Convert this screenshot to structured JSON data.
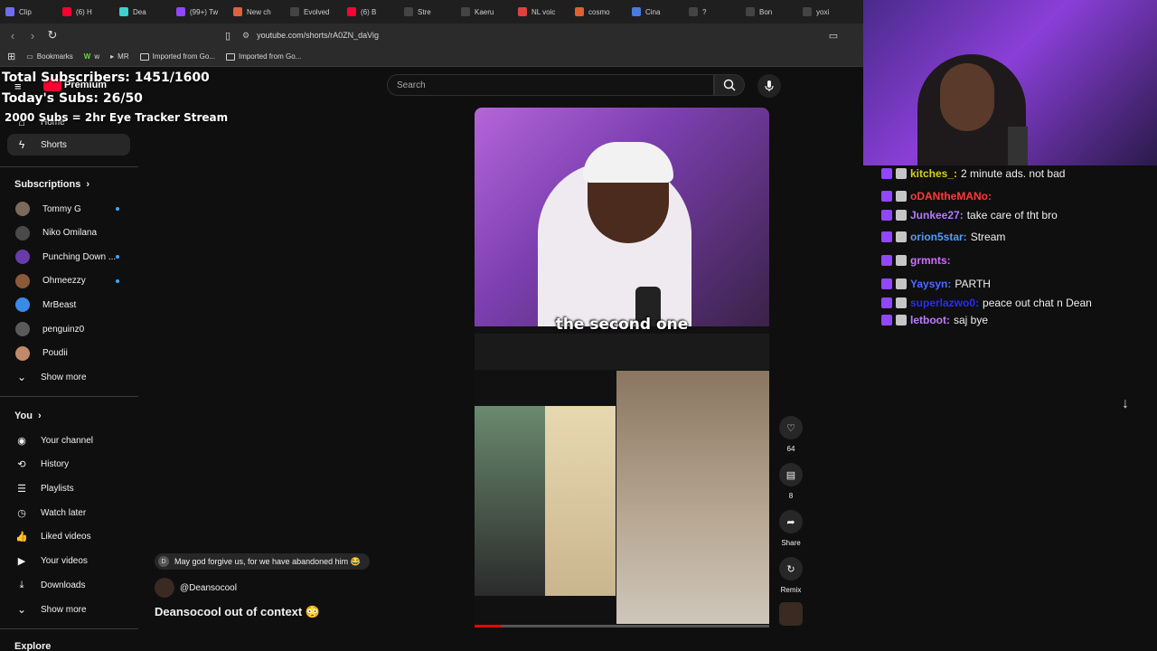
{
  "browser": {
    "tabs": [
      {
        "label": "Clip",
        "color": "#6f6cf0"
      },
      {
        "label": "(6) H",
        "color": "#ff0033"
      },
      {
        "label": "Dea",
        "color": "#3ecfcf"
      },
      {
        "label": "(99+) Tw",
        "color": "#9146ff"
      },
      {
        "label": "New ch",
        "color": "#e06040"
      },
      {
        "label": "Evolved",
        "color": "#444444"
      },
      {
        "label": "(6) B",
        "color": "#ff0033"
      },
      {
        "label": "Stre",
        "color": "#444444"
      },
      {
        "label": "Kaeru",
        "color": "#444444"
      },
      {
        "label": "NL voic",
        "color": "#e04040"
      },
      {
        "label": "cosmo",
        "color": "#e06030"
      },
      {
        "label": "Cina",
        "color": "#4a7be0"
      },
      {
        "label": "?",
        "color": "#444444"
      },
      {
        "label": "Bon",
        "color": "#444444"
      },
      {
        "label": "yoxi",
        "color": "#444444"
      }
    ],
    "url": "youtube.com/shorts/rA0ZN_daVig",
    "bookmarks": [
      {
        "label": "Bookmarks"
      },
      {
        "label": "w"
      },
      {
        "label": "MR"
      },
      {
        "label": "Imported from Go..."
      },
      {
        "label": "Imported from Go..."
      }
    ]
  },
  "overlay": {
    "line1": "Total Subscribers: 1451/1600",
    "line2": "Today's Subs: 26/50",
    "line3": "2000 Subs = 2hr Eye Tracker Stream"
  },
  "youtube": {
    "logo_label": "Premium",
    "search_placeholder": "Search",
    "sidebar": {
      "home": "Home",
      "shorts": "Shorts",
      "subscriptions_heading": "Subscriptions",
      "subscriptions": [
        {
          "name": "Tommy G",
          "color": "#7a6a5a",
          "live": true
        },
        {
          "name": "Niko Omilana",
          "color": "#4a4a4a",
          "live": false
        },
        {
          "name": "Punching Down ...",
          "color": "#6a3aaa",
          "live": true
        },
        {
          "name": "Ohmeezzy",
          "color": "#8a5a3a",
          "live": true
        },
        {
          "name": "MrBeast",
          "color": "#3a8aea",
          "live": false
        },
        {
          "name": "penguinz0",
          "color": "#5a5a5a",
          "live": false
        },
        {
          "name": "Poudii",
          "color": "#c08a6a",
          "live": false
        }
      ],
      "show_more_1": "Show more",
      "you_heading": "You",
      "you_items": [
        {
          "label": "Your channel",
          "icon": "user-icon"
        },
        {
          "label": "History",
          "icon": "history-icon"
        },
        {
          "label": "Playlists",
          "icon": "playlists-icon"
        },
        {
          "label": "Watch later",
          "icon": "clock-icon"
        },
        {
          "label": "Liked videos",
          "icon": "thumbs-up-icon"
        },
        {
          "label": "Your videos",
          "icon": "video-icon"
        },
        {
          "label": "Downloads",
          "icon": "download-icon"
        }
      ],
      "show_more_2": "Show more",
      "explore_heading": "Explore"
    },
    "short": {
      "caption": "the second one",
      "progress": 0.09,
      "comment_pill_avatar": "D",
      "comment_pill_text": "May god forgive us, for we have abandoned him 😂",
      "channel": "@Deansocool",
      "title": "Deansocool out of context 😳",
      "actions": {
        "likes": "64",
        "comments": "8",
        "share": "Share",
        "remix": "Remix"
      }
    }
  },
  "chat": {
    "messages": [
      {
        "user": "kitches_:",
        "text": "2 minute ads. not bad",
        "color": "#d5d020"
      },
      {
        "user": "oDANtheMANo:",
        "text": "",
        "color": "#ff3a3a"
      },
      {
        "user": "Junkee27:",
        "text": "take care of tht bro",
        "color": "#b07aff"
      },
      {
        "user": "orion5star:",
        "text": "Stream",
        "color": "#4aa0ff"
      },
      {
        "user": "grmnts:",
        "text": "",
        "color": "#d070ff"
      },
      {
        "user": "Yaysyn:",
        "text": "PARTH",
        "color": "#4a6aff"
      },
      {
        "user": "superlazwo0:",
        "text": "peace out chat n Dean",
        "color": "#2a2aff"
      },
      {
        "user": "letboot:",
        "text": "saj bye",
        "color": "#c07aff"
      }
    ]
  }
}
